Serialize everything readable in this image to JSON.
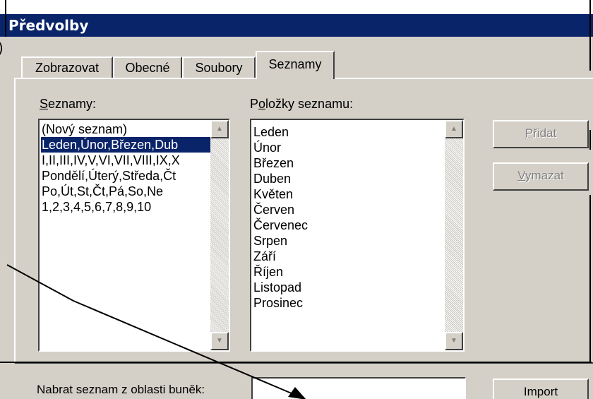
{
  "dialog": {
    "title": "Předvolby"
  },
  "tabs": [
    {
      "label": "Zobrazovat",
      "active": false
    },
    {
      "label": "Obecné",
      "active": false
    },
    {
      "label": "Soubory",
      "active": false
    },
    {
      "label": "Seznamy",
      "active": true
    }
  ],
  "lists": {
    "label_underlined": "S",
    "label_rest": "eznamy:",
    "items": [
      "(Nový seznam)",
      "Leden,Únor,Březen,Dub",
      "I,II,III,IV,V,VI,VII,VIII,IX,X",
      "Pondělí,Úterý,Středa,Čt",
      "Po,Út,St,Čt,Pá,So,Ne",
      "1,2,3,4,5,6,7,8,9,10"
    ],
    "selected_index": 1
  },
  "entries": {
    "label_before": "P",
    "label_underlined": "o",
    "label_rest": "ložky seznamu:",
    "items": [
      "Leden",
      "Únor",
      "Březen",
      "Duben",
      "Květen",
      "Červen",
      "Červenec",
      "Srpen",
      "Září",
      "Říjen",
      "Listopad",
      "Prosinec"
    ]
  },
  "buttons": {
    "add": {
      "underlined": "P",
      "rest": "řidat"
    },
    "delete": {
      "underlined": "V",
      "rest": "ymazat"
    },
    "import": "Import"
  },
  "import_range": {
    "label": "Nabrat seznam z oblasti buněk:",
    "value": ""
  },
  "icons": {
    "scroll_up": "scroll-up-arrow-icon",
    "scroll_down": "scroll-down-arrow-icon"
  },
  "colors": {
    "face": "#d4d0c8",
    "title_bar": "#0a246a",
    "selection": "#0a246a"
  }
}
